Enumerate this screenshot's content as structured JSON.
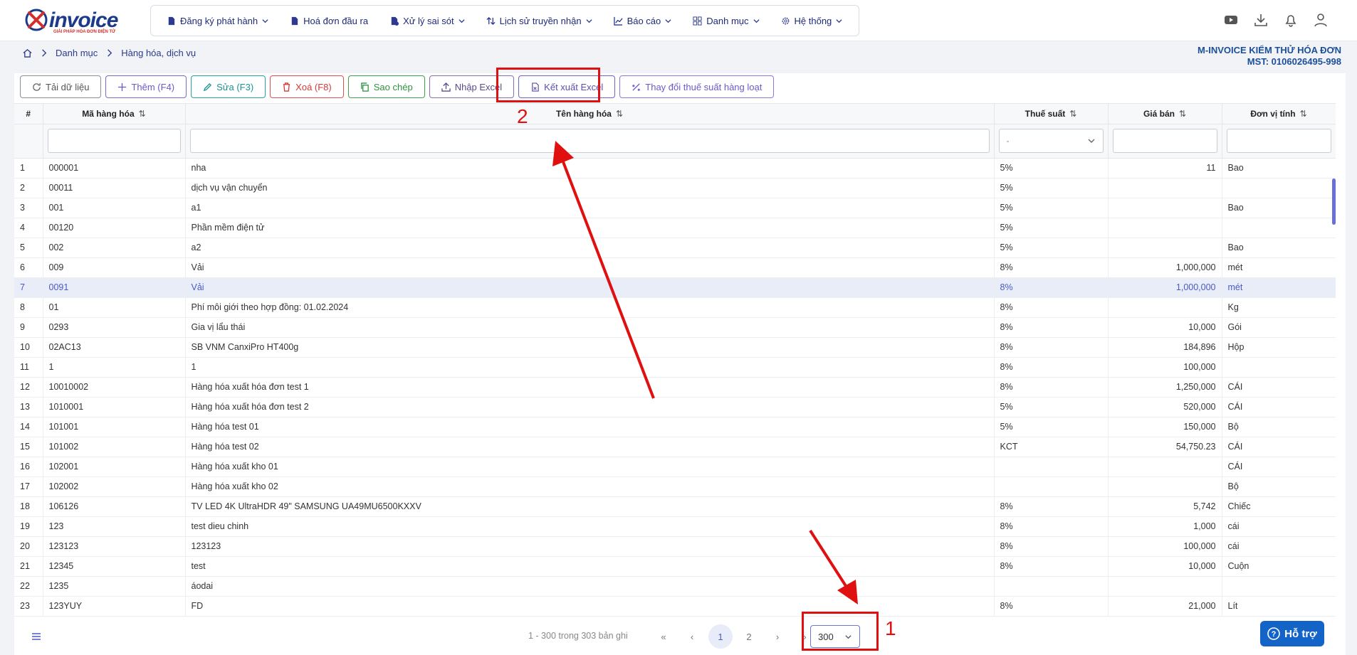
{
  "logo": {
    "text": "invoice",
    "tagline": "GIẢI PHÁP HÓA ĐƠN ĐIỆN TỬ"
  },
  "menu": [
    {
      "label": "Đăng ký phát hành",
      "icon": "file-icon",
      "dropdown": true
    },
    {
      "label": "Hoá đơn đầu ra",
      "icon": "file-icon",
      "dropdown": false
    },
    {
      "label": "Xử lý sai sót",
      "icon": "file-error-icon",
      "dropdown": true
    },
    {
      "label": "Lịch sử truyền nhận",
      "icon": "transfer-icon",
      "dropdown": true
    },
    {
      "label": "Báo cáo",
      "icon": "chart-icon",
      "dropdown": true
    },
    {
      "label": "Danh mục",
      "icon": "grid-icon",
      "dropdown": true
    },
    {
      "label": "Hệ thống",
      "icon": "gear-icon",
      "dropdown": true
    }
  ],
  "breadcrumb": {
    "level1": "Danh mục",
    "level2": "Hàng hóa, dịch vụ"
  },
  "company": {
    "name": "M-INVOICE KIỂM THỬ HÓA ĐƠN",
    "tax": "MST: 0106026495-998"
  },
  "toolbar": {
    "reload": "Tải dữ liệu",
    "add": "Thêm (F4)",
    "edit": "Sửa (F3)",
    "delete": "Xoá (F8)",
    "copy": "Sao chép",
    "import": "Nhập Excel",
    "export": "Kết xuất Excel",
    "tax_change": "Thay đổi thuế suất hàng loạt"
  },
  "columns": {
    "idx": "#",
    "code": "Mã hàng hóa",
    "name": "Tên hàng hóa",
    "tax": "Thuế suất",
    "price": "Giá bán",
    "unit": "Đơn vị tính"
  },
  "filter": {
    "tax_value": "-"
  },
  "rows": [
    {
      "i": "1",
      "code": "000001",
      "name": "nha",
      "tax": "5%",
      "price": "11",
      "unit": "Bao"
    },
    {
      "i": "2",
      "code": "00011",
      "name": "dịch vụ vận chuyển",
      "tax": "5%",
      "price": "",
      "unit": ""
    },
    {
      "i": "3",
      "code": "001",
      "name": "a1",
      "tax": "5%",
      "price": "",
      "unit": "Bao"
    },
    {
      "i": "4",
      "code": "00120",
      "name": "Phần mềm điện tử",
      "tax": "5%",
      "price": "",
      "unit": ""
    },
    {
      "i": "5",
      "code": "002",
      "name": "a2",
      "tax": "5%",
      "price": "",
      "unit": "Bao"
    },
    {
      "i": "6",
      "code": "009",
      "name": "Vải",
      "tax": "8%",
      "price": "1,000,000",
      "unit": "mét"
    },
    {
      "i": "7",
      "code": "0091",
      "name": "Vải",
      "tax": "8%",
      "price": "1,000,000",
      "unit": "mét"
    },
    {
      "i": "8",
      "code": "01",
      "name": "Phí môi giới theo hợp đồng: 01.02.2024",
      "tax": "8%",
      "price": "",
      "unit": "Kg"
    },
    {
      "i": "9",
      "code": "0293",
      "name": "Gia vị lẩu thái",
      "tax": "8%",
      "price": "10,000",
      "unit": "Gói"
    },
    {
      "i": "10",
      "code": "02AC13",
      "name": "SB VNM CanxiPro HT400g",
      "tax": "8%",
      "price": "184,896",
      "unit": "Hộp"
    },
    {
      "i": "11",
      "code": "1",
      "name": "1",
      "tax": "8%",
      "price": "100,000",
      "unit": ""
    },
    {
      "i": "12",
      "code": "10010002",
      "name": "Hàng hóa xuất hóa đơn test 1",
      "tax": "8%",
      "price": "1,250,000",
      "unit": "CÁI"
    },
    {
      "i": "13",
      "code": "1010001",
      "name": "Hàng hóa xuất hóa đơn test 2",
      "tax": "5%",
      "price": "520,000",
      "unit": "CÁI"
    },
    {
      "i": "14",
      "code": "101001",
      "name": "Hàng hóa test 01",
      "tax": "5%",
      "price": "150,000",
      "unit": "Bộ"
    },
    {
      "i": "15",
      "code": "101002",
      "name": "Hàng hóa test 02",
      "tax": "KCT",
      "price": "54,750.23",
      "unit": "CÁI"
    },
    {
      "i": "16",
      "code": "102001",
      "name": "Hàng hóa xuất kho 01",
      "tax": "",
      "price": "",
      "unit": "CÁI"
    },
    {
      "i": "17",
      "code": "102002",
      "name": "Hàng hóa xuất kho 02",
      "tax": "",
      "price": "",
      "unit": "Bộ"
    },
    {
      "i": "18",
      "code": "106126",
      "name": "TV LED 4K UltraHDR 49\" SAMSUNG UA49MU6500KXXV",
      "tax": "8%",
      "price": "5,742",
      "unit": "Chiếc"
    },
    {
      "i": "19",
      "code": "123",
      "name": "test dieu chinh",
      "tax": "8%",
      "price": "1,000",
      "unit": "cái"
    },
    {
      "i": "20",
      "code": "123123",
      "name": "123123",
      "tax": "8%",
      "price": "100,000",
      "unit": "cái"
    },
    {
      "i": "21",
      "code": "12345",
      "name": "test",
      "tax": "8%",
      "price": "10,000",
      "unit": "Cuộn"
    },
    {
      "i": "22",
      "code": "1235",
      "name": "áodai",
      "tax": "",
      "price": "",
      "unit": ""
    },
    {
      "i": "23",
      "code": "123YUY",
      "name": "FD",
      "tax": "8%",
      "price": "21,000",
      "unit": "Lít"
    }
  ],
  "selected_row": "7",
  "pager": {
    "info": "1 - 300 trong 303 bản ghi",
    "first": "«",
    "prev": "‹",
    "page1": "1",
    "page2": "2",
    "next": "›",
    "last": "»",
    "page_size": "300"
  },
  "support": {
    "label": "Hỗ trợ"
  },
  "annotations": {
    "one": "1",
    "two": "2"
  }
}
